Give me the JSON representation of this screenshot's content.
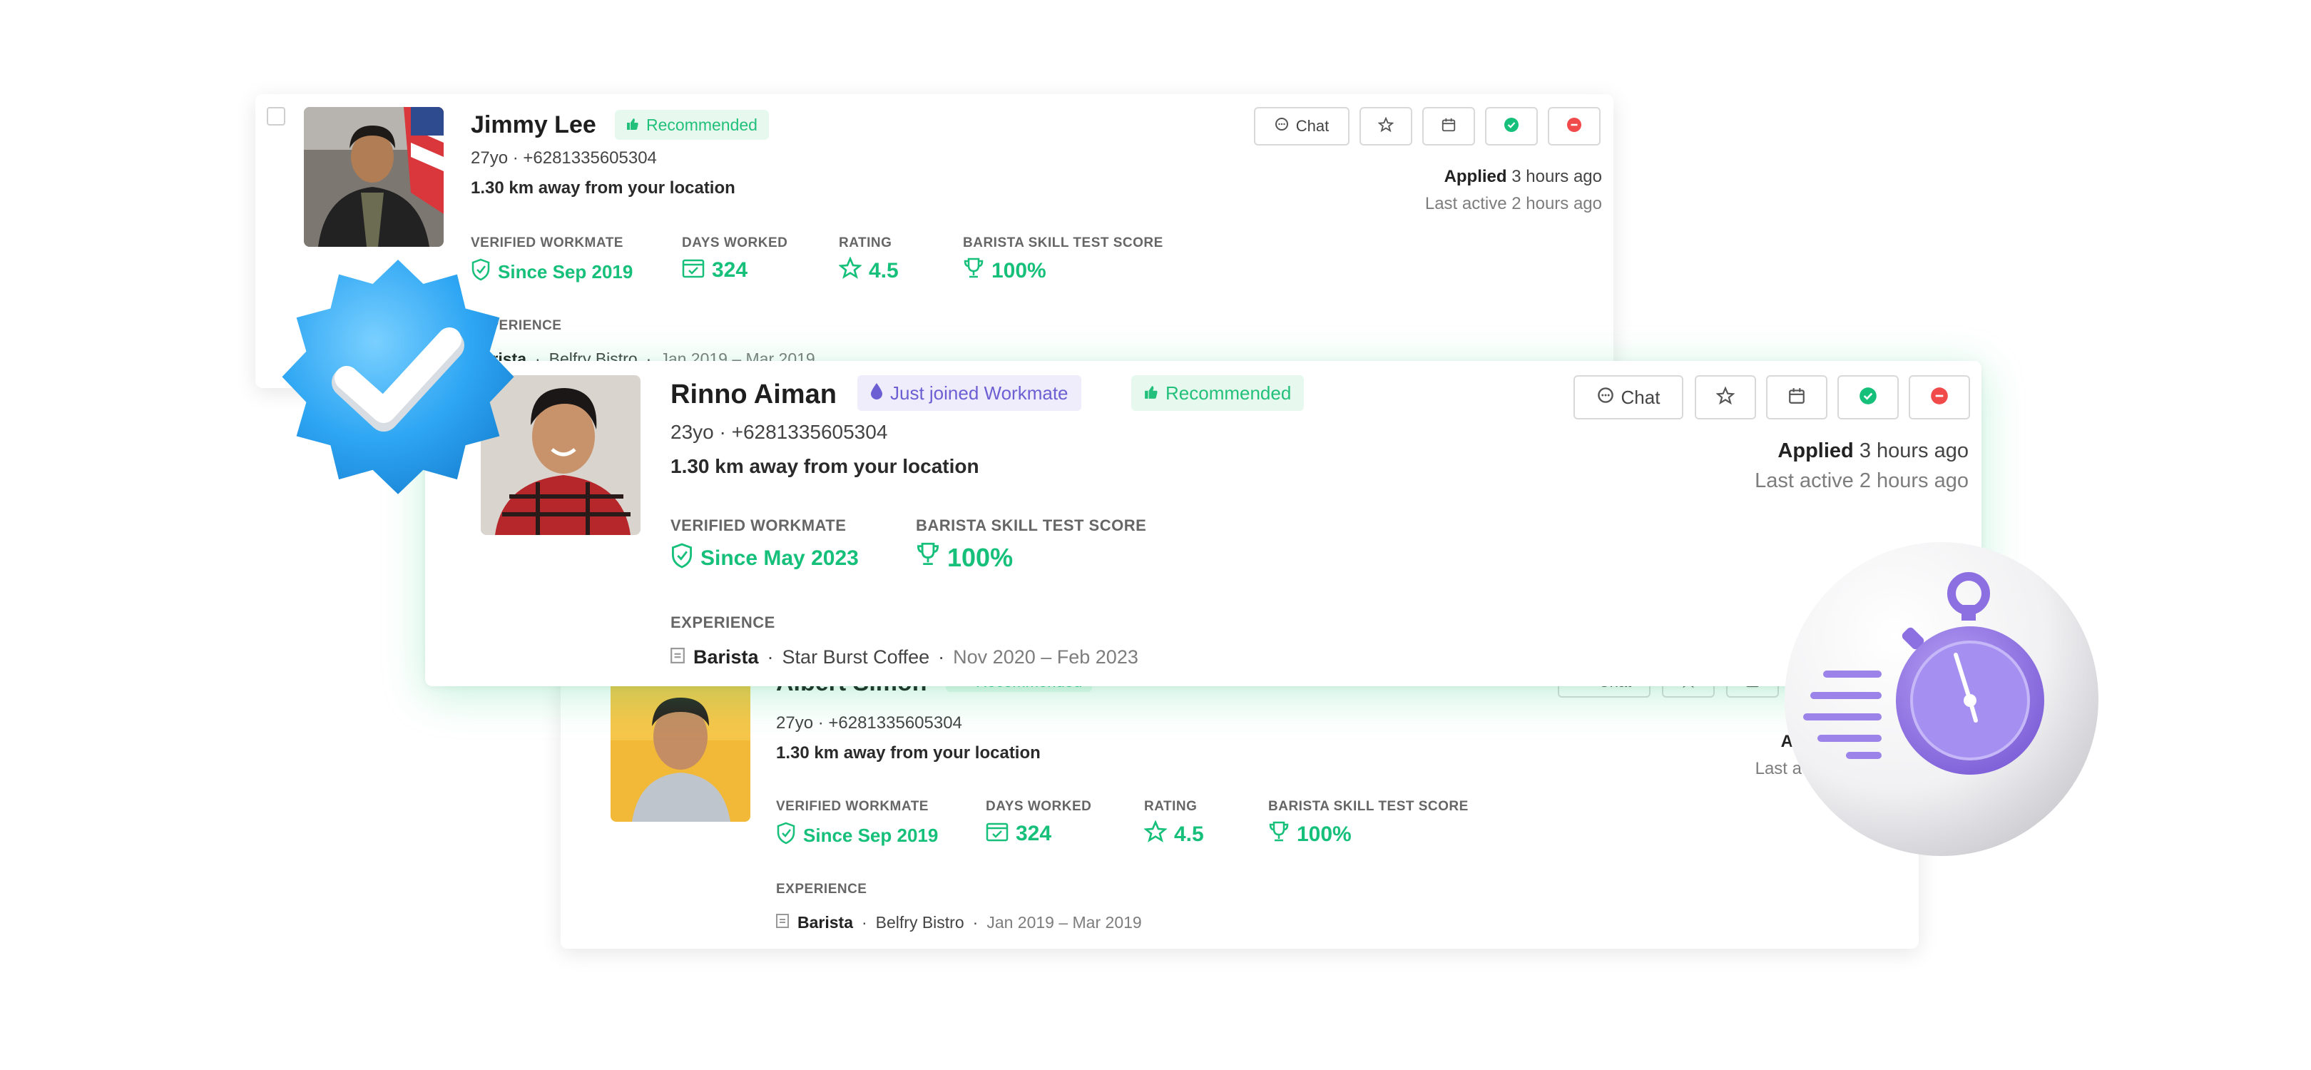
{
  "cards": {
    "top": {
      "name": "Jimmy Lee",
      "recommended": "Recommended",
      "meta": "27yo · +6281335605304",
      "distance": "1.30 km away from your location",
      "chat": "Chat",
      "applied_label": "Applied",
      "applied_time": "3 hours ago",
      "last_active": "Last active 2 hours ago",
      "stats": {
        "verified_label": "VERIFIED WORKMATE",
        "verified_value": "Since Sep 2019",
        "days_label": "DAYS WORKED",
        "days_value": "324",
        "rating_label": "RATING",
        "rating_value": "4.5",
        "skill_label": "BARISTA SKILL TEST SCORE",
        "skill_value": "100%"
      },
      "experience_label": "EXPERIENCE",
      "experience": {
        "role": "Barista",
        "company": "Belfry Bistro",
        "dates": "Jan 2019 – Mar 2019"
      }
    },
    "middle": {
      "name": "Rinno Aiman",
      "new_badge": "Just joined Workmate",
      "recommended": "Recommended",
      "meta": "23yo · +6281335605304",
      "distance": "1.30 km away from your location",
      "chat": "Chat",
      "applied_label": "Applied",
      "applied_time": "3 hours ago",
      "last_active": "Last active 2 hours ago",
      "stats": {
        "verified_label": "VERIFIED WORKMATE",
        "verified_value": "Since May 2023",
        "skill_label": "BARISTA SKILL TEST SCORE",
        "skill_value": "100%"
      },
      "experience_label": "EXPERIENCE",
      "experience": {
        "role": "Barista",
        "company": "Star Burst Coffee",
        "dates": "Nov 2020 – Feb 2023"
      }
    },
    "bottom": {
      "name": "Albert Simon",
      "recommended": "Recommended",
      "meta": "27yo · +6281335605304",
      "distance": "1.30 km away from your location",
      "chat": "Chat",
      "applied_label": "Appl",
      "last_active": "Last acti",
      "stats": {
        "verified_label": "VERIFIED WORKMATE",
        "verified_value": "Since Sep 2019",
        "days_label": "DAYS WORKED",
        "days_value": "324",
        "rating_label": "RATING",
        "rating_value": "4.5",
        "skill_label": "BARISTA SKILL TEST SCORE",
        "skill_value": "100%"
      },
      "experience_label": "EXPERIENCE",
      "experience": {
        "role": "Barista",
        "company": "Belfry Bistro",
        "dates": "Jan 2019 – Mar 2019"
      }
    }
  },
  "colors": {
    "accent": "#16c07a",
    "purple": "#8c6fe0",
    "verified_blue": "#38aef5",
    "danger": "#f04a4a"
  },
  "icons": [
    "chat-icon",
    "star-icon",
    "calendar-icon",
    "check-circle-icon",
    "minus-circle-icon",
    "shield-check-icon",
    "trophy-icon",
    "thumbs-up-icon",
    "drop-icon",
    "verified-badge-icon",
    "stopwatch-icon"
  ]
}
